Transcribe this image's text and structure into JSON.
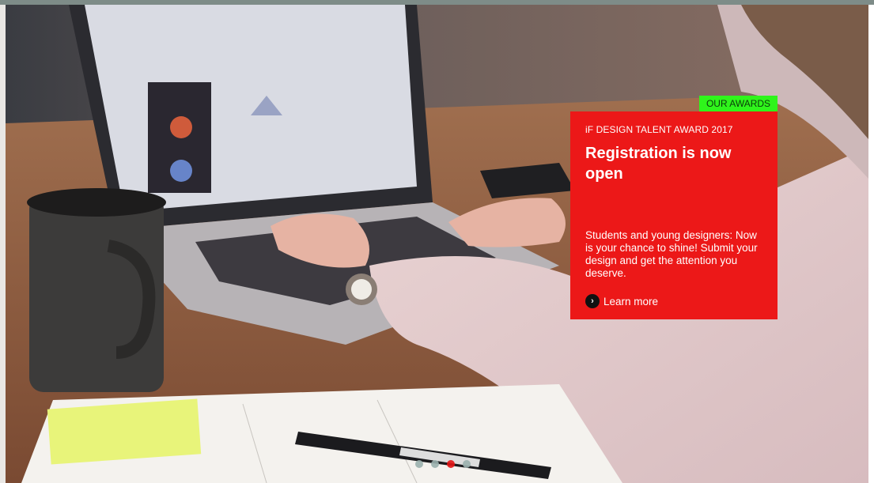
{
  "promo": {
    "tag": "OUR AWARDS",
    "kicker": "iF DESIGN TALENT AWARD 2017",
    "title": "Registration is now open",
    "description": "Students and young designers: Now is your chance to shine! Submit your design and get the attention you deserve.",
    "cta_label": "Learn more",
    "cta_icon": "chevron-right-icon"
  },
  "slider": {
    "slide_count": 4,
    "active_index": 2
  },
  "colors": {
    "card": "#ec1818",
    "tag": "#2ff51b",
    "active_dot": "#e31414"
  }
}
